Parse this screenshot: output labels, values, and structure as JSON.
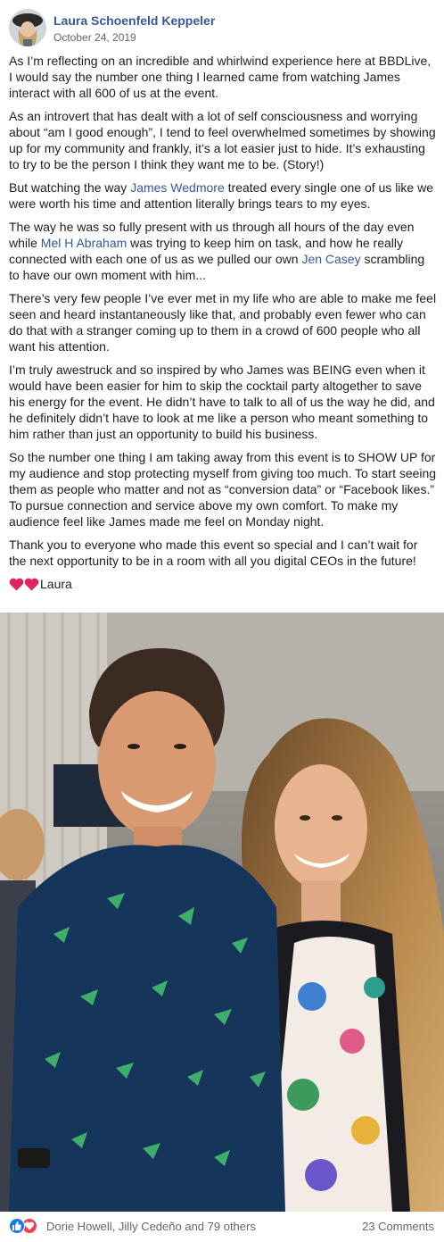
{
  "post": {
    "author": "Laura Schoenfeld Keppeler",
    "date": "October 24, 2019",
    "paragraphs": {
      "p1": "As I’m reflecting on an incredible and whirlwind experience here at BBDLive, I would say the number one thing I learned came from watching James interact with all 600 of us at the event.",
      "p2": "As an introvert that has dealt with a lot of self consciousness and worrying about “am I good enough”, I tend to feel overwhelmed sometimes by showing up for my community and frankly, it’s a lot easier just to hide. It’s exhausting to try to be the person I think they want me to be. (Story!)",
      "p3_before": "But watching the way ",
      "p3_mention": "James Wedmore",
      "p3_after": " treated every single one of us like we were worth his time and attention literally brings tears to my eyes.",
      "p4_before": "The way he was so fully present with us through all hours of the day even while ",
      "p4_mention1": "Mel H Abraham",
      "p4_middle": " was trying to keep him on task, and how he really connected with each one of us as we pulled our own ",
      "p4_mention2": "Jen Casey",
      "p4_after": " scrambling to have our own moment with him...",
      "p5": "There’s very few people I’ve ever met in my life who are able to make me feel seen and heard instantaneously like that, and probably even fewer who can do that with a stranger coming up to them in a crowd of 600 people who all want his attention.",
      "p6": "I’m truly awestruck and so inspired by who James was BEING even when it would have been easier for him to skip the cocktail party altogether to save his energy for the event. He didn’t have to talk to all of us the way he did, and he definitely didn’t have to look at me like a person who meant something to him rather than just an opportunity to build his business.",
      "p7": "So the number one thing I am taking away from this event is to SHOW UP for my audience and stop protecting myself from giving too much. To start seeing them as people who matter and not as “conversion data” or “Facebook likes.” To pursue connection and service above my own comfort. To make my audience feel like James made me feel on Monday night.",
      "p8": "Thank you to everyone who made this event so special and I can’t wait for the next opportunity to be in a room with all you digital CEOs in the future!",
      "signoff": "Laura"
    },
    "photo_icon": "photo-two-people-icon",
    "heart_icon": "red-heart-emoji-icon"
  },
  "footer": {
    "reactions": [
      "like-icon",
      "love-icon"
    ],
    "reactors": "Dorie Howell, Jilly Cedeño and 79 others",
    "comments": "23 Comments"
  },
  "colors": {
    "link": "#385898",
    "text": "#1c1e21",
    "meta": "#606770",
    "like": "#1877f2",
    "love": "#f33e58",
    "heart_emoji": "#e0245e"
  }
}
